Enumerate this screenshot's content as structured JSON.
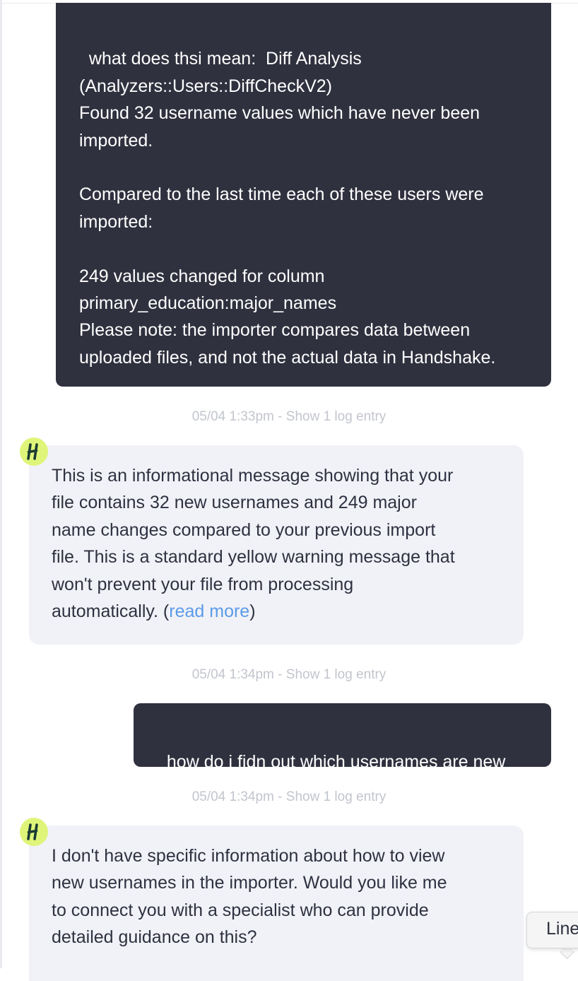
{
  "colors": {
    "user_bubble_bg": "#30313f",
    "bot_bubble_bg": "#f1f2f7",
    "avatar_bg": "#dff57a",
    "link": "#5b9be8",
    "timestamp": "#c2c5cd"
  },
  "messages": [
    {
      "role": "user",
      "text": "what does thsi mean:  Diff Analysis\n(Analyzers::Users::DiffCheckV2)\nFound 32 username values which have never been imported.\n\nCompared to the last time each of these users were imported:\n\n249 values changed for column primary_education:major_names\nPlease note: the importer compares data between uploaded files, and not the actual data in Handshake."
    },
    {
      "role": "meta",
      "timestamp": "05/04 1:33pm - Show 1 log entry"
    },
    {
      "role": "bot",
      "avatar_letter": "H",
      "avatar_icon": "handshake-logo-icon",
      "lines": [
        "This is an informational message showing that your",
        "file contains 32 new usernames and 249 major",
        "name changes compared to your previous import",
        "file. This is a standard yellow warning message that",
        "won't prevent your file from processing"
      ],
      "last_line_prefix": "automatically. (",
      "link_text": "read more",
      "last_line_suffix": ")"
    },
    {
      "role": "meta",
      "timestamp": "05/04 1:34pm - Show 1 log entry"
    },
    {
      "role": "user",
      "text": "how do i fidn out which usernames are new"
    },
    {
      "role": "meta",
      "timestamp": "05/04 1:34pm - Show 1 log entry"
    },
    {
      "role": "bot",
      "avatar_letter": "H",
      "avatar_icon": "handshake-logo-icon",
      "lines": [
        "I don't have specific information about how to view",
        "new usernames in the importer. Would you like me",
        "to connect you with a specialist who can provide",
        "detailed guidance on this?"
      ]
    }
  ],
  "tooltip": {
    "text": "Line"
  }
}
